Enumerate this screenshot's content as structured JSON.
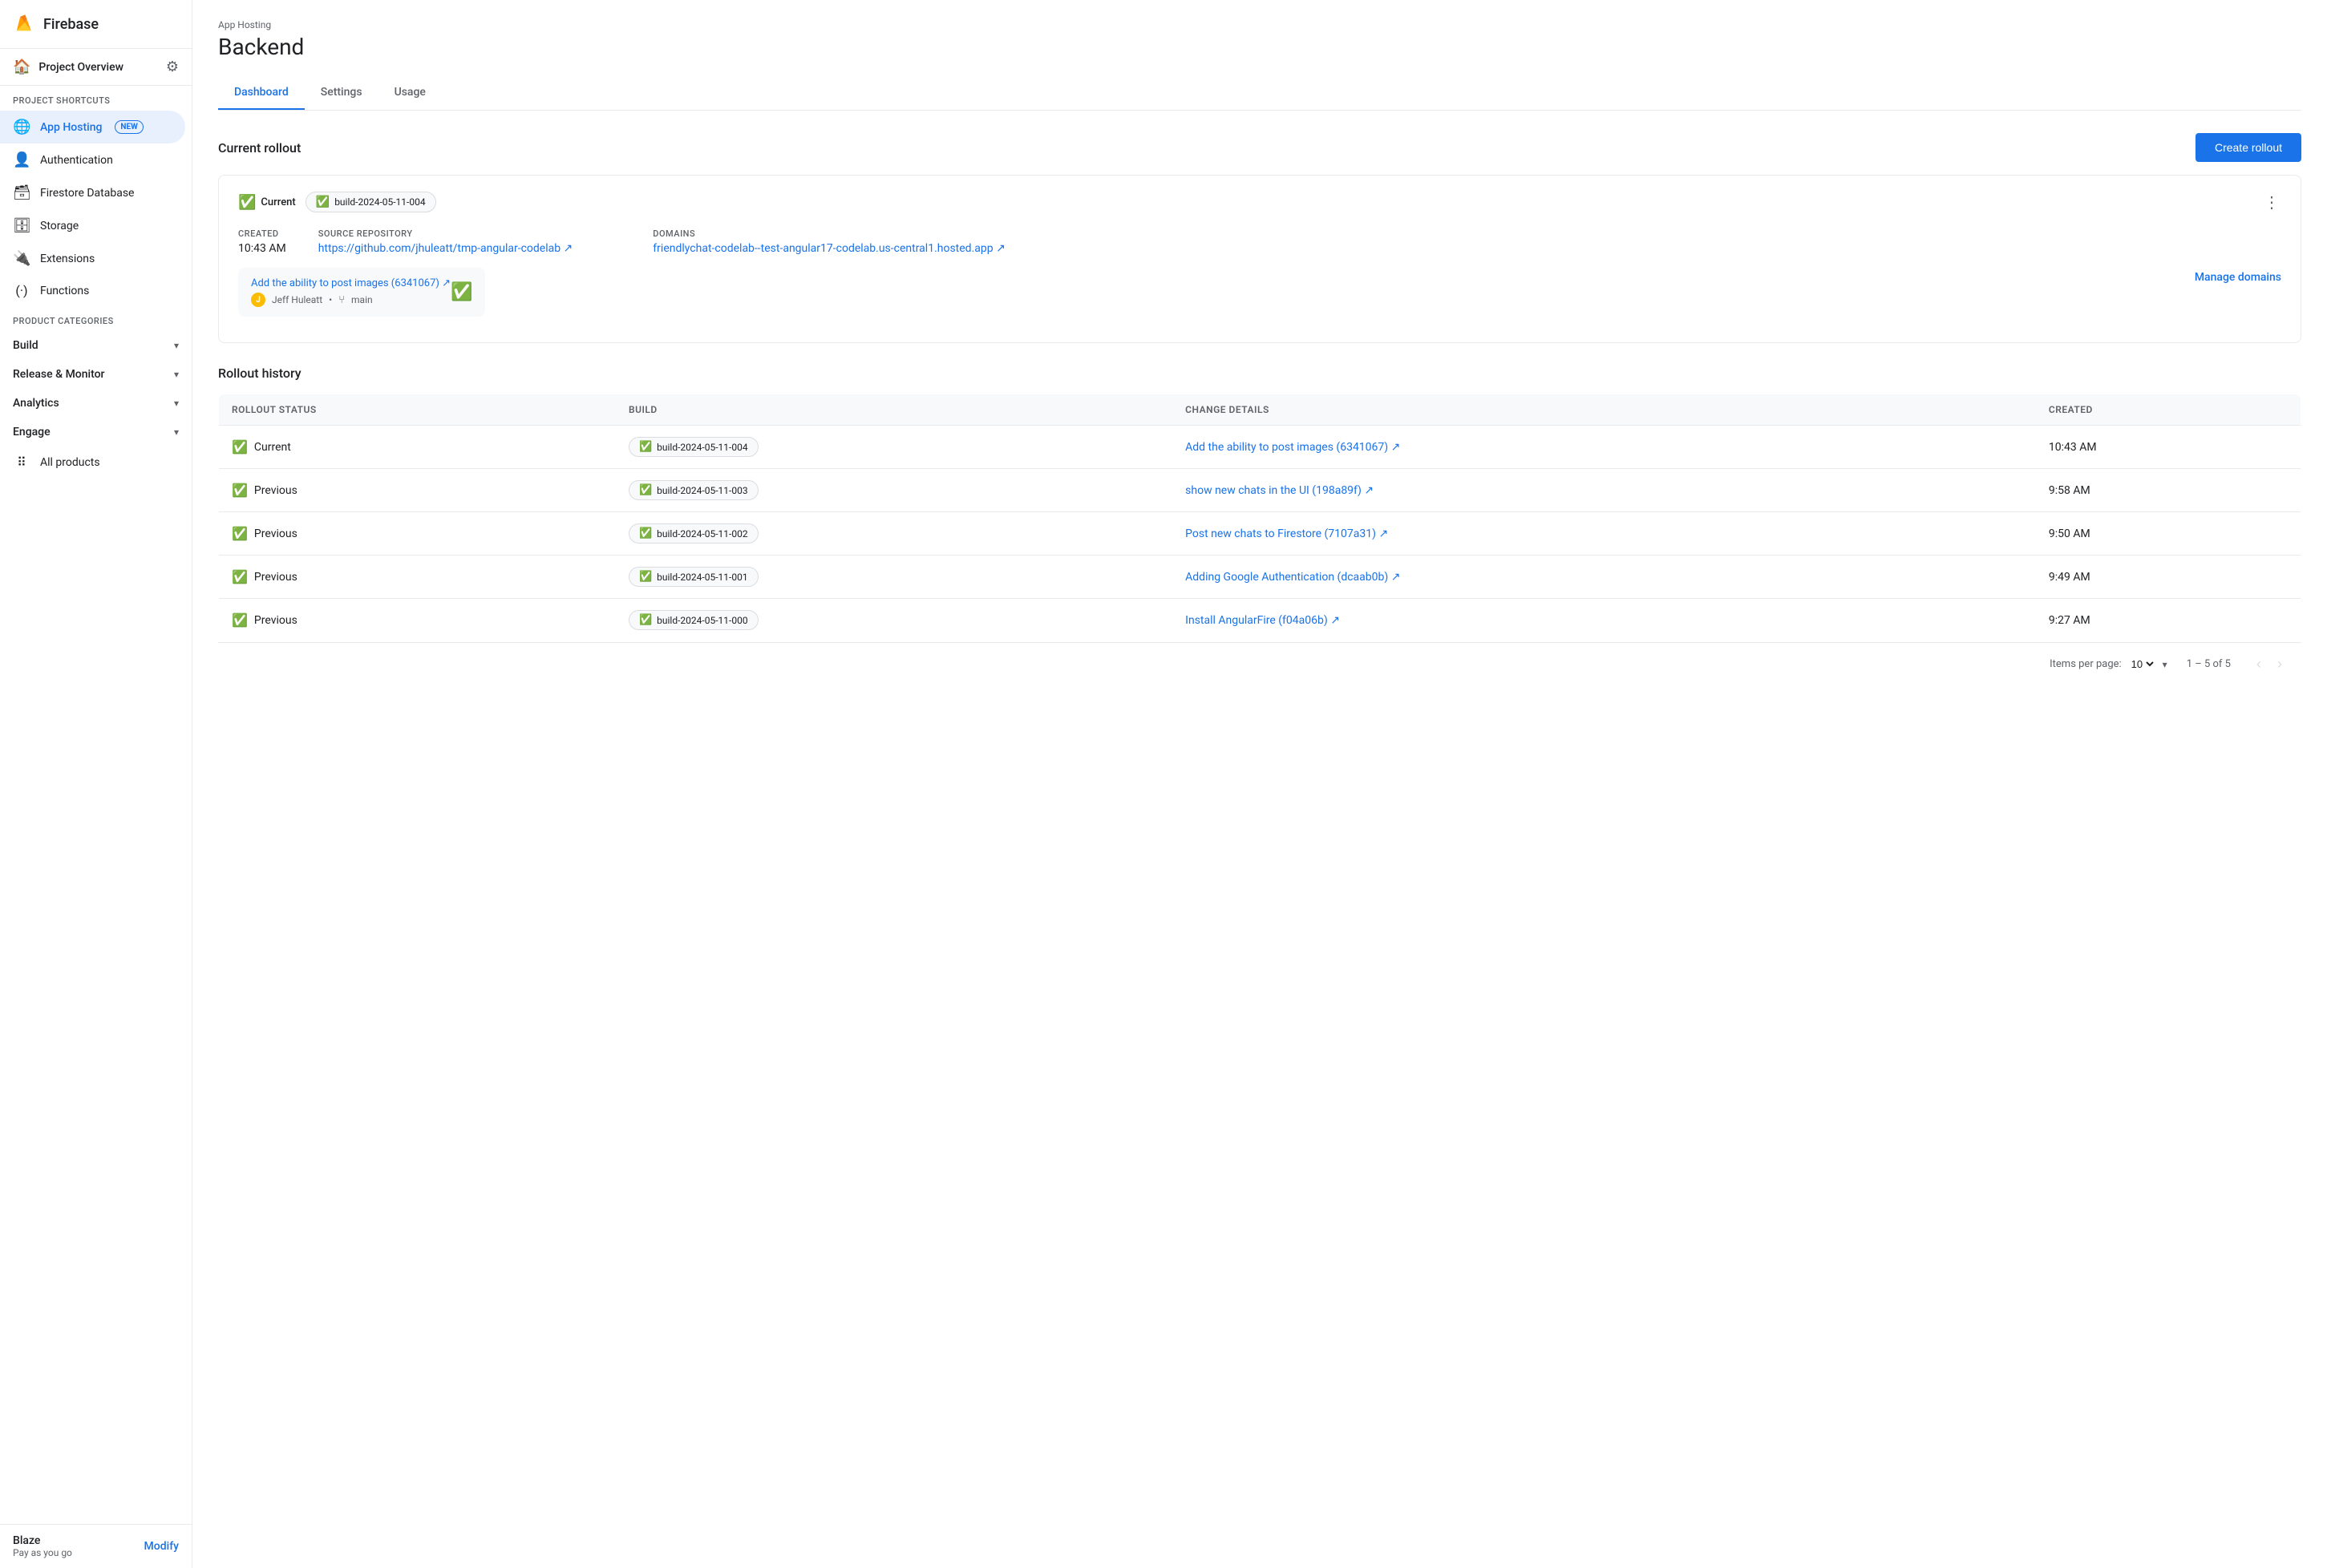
{
  "sidebar": {
    "app_title": "Firebase",
    "project_name": "Project Overview",
    "section_label": "Project shortcuts",
    "product_categories_label": "Product categories",
    "items": [
      {
        "id": "app-hosting",
        "label": "App Hosting",
        "badge": "NEW",
        "active": true
      },
      {
        "id": "authentication",
        "label": "Authentication"
      },
      {
        "id": "firestore",
        "label": "Firestore Database"
      },
      {
        "id": "storage",
        "label": "Storage"
      },
      {
        "id": "extensions",
        "label": "Extensions"
      },
      {
        "id": "functions",
        "label": "Functions"
      }
    ],
    "categories": [
      {
        "id": "build",
        "label": "Build"
      },
      {
        "id": "release-monitor",
        "label": "Release & Monitor"
      },
      {
        "id": "analytics",
        "label": "Analytics"
      },
      {
        "id": "engage",
        "label": "Engage"
      }
    ],
    "all_products": "All products",
    "plan": {
      "name": "Blaze",
      "sub": "Pay as you go",
      "modify": "Modify"
    }
  },
  "header": {
    "breadcrumb": "App Hosting",
    "title": "Backend",
    "tabs": [
      "Dashboard",
      "Settings",
      "Usage"
    ],
    "active_tab": "Dashboard"
  },
  "current_rollout": {
    "section_title": "Current rollout",
    "create_button": "Create rollout",
    "status": "Current",
    "build_id": "build-2024-05-11-004",
    "created_label": "Created",
    "created_value": "10:43 AM",
    "source_repo_label": "Source repository",
    "source_repo_url": "https://github.com/jhuleatt/tmp-angular-codelab",
    "source_repo_display": "https://github.com/jhuleatt/tmp-angular-codelab ↗",
    "domains_label": "Domains",
    "domains_url": "friendlychat-codelab--test-angular17-codelab.us-central1.hosted.app",
    "domains_display": "friendlychat-codelab--test-angular17-codelab.us-central1.hosted.app ↗",
    "commit_text": "Add the ability to post images (6341067) ↗",
    "commit_author": "Jeff Huleatt",
    "commit_branch": "main",
    "manage_domains": "Manage domains"
  },
  "rollout_history": {
    "section_title": "Rollout history",
    "columns": [
      "Rollout Status",
      "Build",
      "Change details",
      "Created"
    ],
    "rows": [
      {
        "status": "Current",
        "build": "build-2024-05-11-004",
        "change": "Add the ability to post images (6341067) ↗",
        "created": "10:43 AM"
      },
      {
        "status": "Previous",
        "build": "build-2024-05-11-003",
        "change": "show new chats in the UI (198a89f) ↗",
        "created": "9:58 AM"
      },
      {
        "status": "Previous",
        "build": "build-2024-05-11-002",
        "change": "Post new chats to Firestore (7107a31) ↗",
        "created": "9:50 AM"
      },
      {
        "status": "Previous",
        "build": "build-2024-05-11-001",
        "change": "Adding Google Authentication (dcaab0b) ↗",
        "created": "9:49 AM"
      },
      {
        "status": "Previous",
        "build": "build-2024-05-11-000",
        "change": "Install AngularFire (f04a06b) ↗",
        "created": "9:27 AM"
      }
    ],
    "pagination": {
      "items_per_page_label": "Items per page:",
      "items_per_page_value": "10",
      "page_range": "1 – 5 of 5"
    }
  }
}
